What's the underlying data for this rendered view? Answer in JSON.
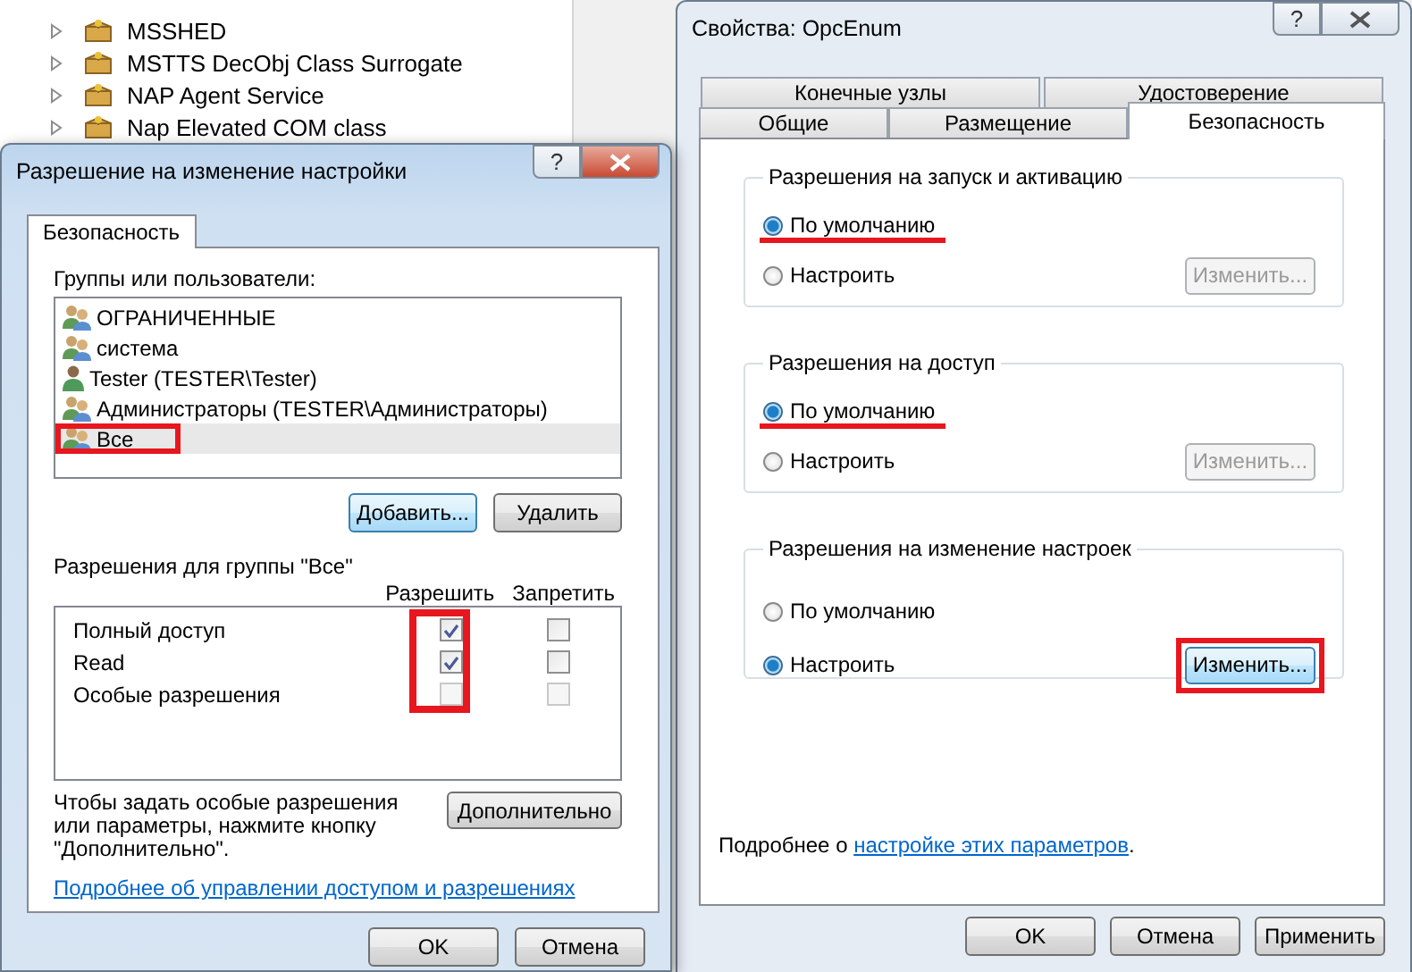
{
  "background_list": {
    "items": [
      {
        "label": "MSSHED"
      },
      {
        "label": "MSTTS DecObj Class Surrogate"
      },
      {
        "label": "NAP Agent Service"
      },
      {
        "label": "Nap Elevated COM class"
      }
    ]
  },
  "properties_dialog": {
    "title": "Свойства: OpcEnum",
    "help": "?",
    "tab_rows": [
      {
        "tabs": [
          {
            "label": "Конечные узлы",
            "selected": false
          },
          {
            "label": "Удостоверение",
            "selected": false
          }
        ]
      },
      {
        "tabs": [
          {
            "label": "Общие",
            "selected": false
          },
          {
            "label": "Размещение",
            "selected": false
          },
          {
            "label": "Безопасность",
            "selected": true
          }
        ]
      }
    ],
    "groups": [
      {
        "title": "Разрешения на запуск и активацию",
        "options": [
          {
            "label": "По умолчанию",
            "selected": true,
            "underlined": true
          },
          {
            "label": "Настроить",
            "selected": false,
            "underlined": false
          }
        ],
        "button": {
          "label": "Изменить...",
          "disabled": true,
          "highlighted": false
        }
      },
      {
        "title": "Разрешения на доступ",
        "options": [
          {
            "label": "По умолчанию",
            "selected": true,
            "underlined": true
          },
          {
            "label": "Настроить",
            "selected": false,
            "underlined": false
          }
        ],
        "button": {
          "label": "Изменить...",
          "disabled": true,
          "highlighted": false
        }
      },
      {
        "title": "Разрешения на изменение настроек",
        "options": [
          {
            "label": "По умолчанию",
            "selected": false,
            "underlined": false
          },
          {
            "label": "Настроить",
            "selected": true,
            "underlined": false
          }
        ],
        "button": {
          "label": "Изменить...",
          "disabled": false,
          "highlighted": true
        }
      }
    ],
    "footer": {
      "text": "Подробнее о ",
      "link": "настройке этих параметров",
      "suffix": "."
    },
    "buttons": [
      {
        "label": "OK"
      },
      {
        "label": "Отмена"
      },
      {
        "label": "Применить"
      }
    ]
  },
  "permission_dialog": {
    "title": "Разрешение на изменение настройки",
    "help": "?",
    "tab": {
      "label": "Безопасность",
      "selected": true
    },
    "users_label": "Группы или пользователи:",
    "users": [
      {
        "name": "ОГРАНИЧЕННЫЕ",
        "kind": "group",
        "selected": false,
        "highlighted": false
      },
      {
        "name": "система",
        "kind": "group",
        "selected": false,
        "highlighted": false
      },
      {
        "name": "Tester (TESTER\\Tester)",
        "kind": "user",
        "selected": false,
        "highlighted": false
      },
      {
        "name": "Администраторы (TESTER\\Администраторы)",
        "kind": "group",
        "selected": false,
        "highlighted": false
      },
      {
        "name": "Все",
        "kind": "group",
        "selected": true,
        "highlighted": true
      }
    ],
    "user_buttons": [
      {
        "label": "Добавить...",
        "focused": true
      },
      {
        "label": "Удалить",
        "focused": false
      }
    ],
    "permissions_label": "Разрешения для группы \"Все\"",
    "columns": [
      "Разрешить",
      "Запретить"
    ],
    "allow_highlighted": true,
    "permissions": [
      {
        "name": "Полный доступ",
        "allow": true,
        "deny": false,
        "disabled": false
      },
      {
        "name": "Read",
        "allow": true,
        "deny": false,
        "disabled": false
      },
      {
        "name": "Особые разрешения",
        "allow": false,
        "deny": false,
        "disabled": true
      }
    ],
    "note": "Чтобы задать особые разрешения или параметры, нажмите кнопку \"Дополнительно\".",
    "advanced_button": "Дополнительно",
    "link": "Подробнее об управлении доступом и разрешениях",
    "buttons": [
      {
        "label": "OK"
      },
      {
        "label": "Отмена"
      }
    ]
  }
}
